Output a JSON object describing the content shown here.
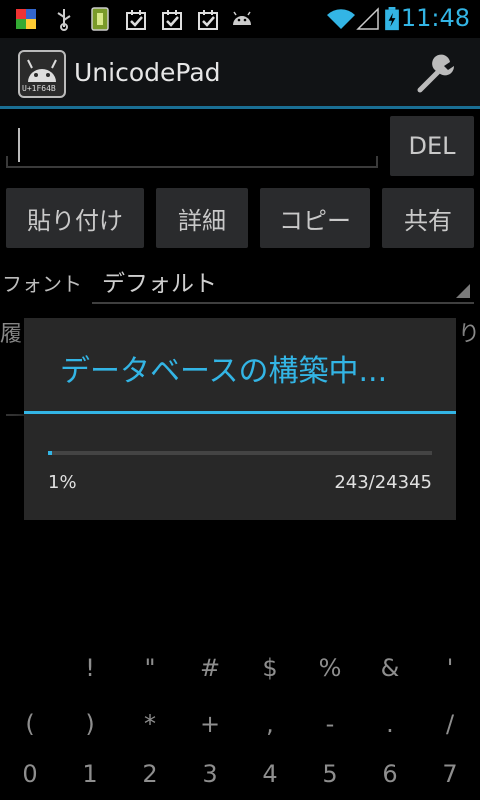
{
  "status_bar": {
    "time": "11:48",
    "icons": [
      "photo-icon",
      "usb-icon",
      "battery-app-icon",
      "check-icon",
      "check-icon",
      "check-icon",
      "android-icon"
    ],
    "right_icons": [
      "wifi-icon",
      "signal-icon",
      "battery-icon"
    ]
  },
  "action_bar": {
    "app_title": "UnicodePad",
    "app_icon_text": "U+1F64B",
    "settings_icon": "wrench-icon"
  },
  "text_input": {
    "value": ""
  },
  "buttons": {
    "del": "DEL",
    "paste": "貼り付け",
    "detail": "詳細",
    "copy": "コピー",
    "share": "共有"
  },
  "font_row": {
    "label": "フォント",
    "value": "デフォルト"
  },
  "background": {
    "history_tab_partial": "履",
    "right_partial": "り"
  },
  "dialog": {
    "title": "データベースの構築中...",
    "progress_percent_text": "1%",
    "progress_count_text": "243/24345",
    "progress_fraction": 0.01
  },
  "char_grid": {
    "rows": [
      [
        "",
        "!",
        "\"",
        "#",
        "$",
        "%",
        "&",
        "'"
      ],
      [
        "(",
        ")",
        "*",
        "+",
        ",",
        "-",
        ".",
        "/"
      ],
      [
        "0",
        "1",
        "2",
        "3",
        "4",
        "5",
        "6",
        "7"
      ]
    ]
  },
  "colors": {
    "accent": "#33b5e5",
    "background": "#000000",
    "button_bg": "#2a2b2d"
  }
}
